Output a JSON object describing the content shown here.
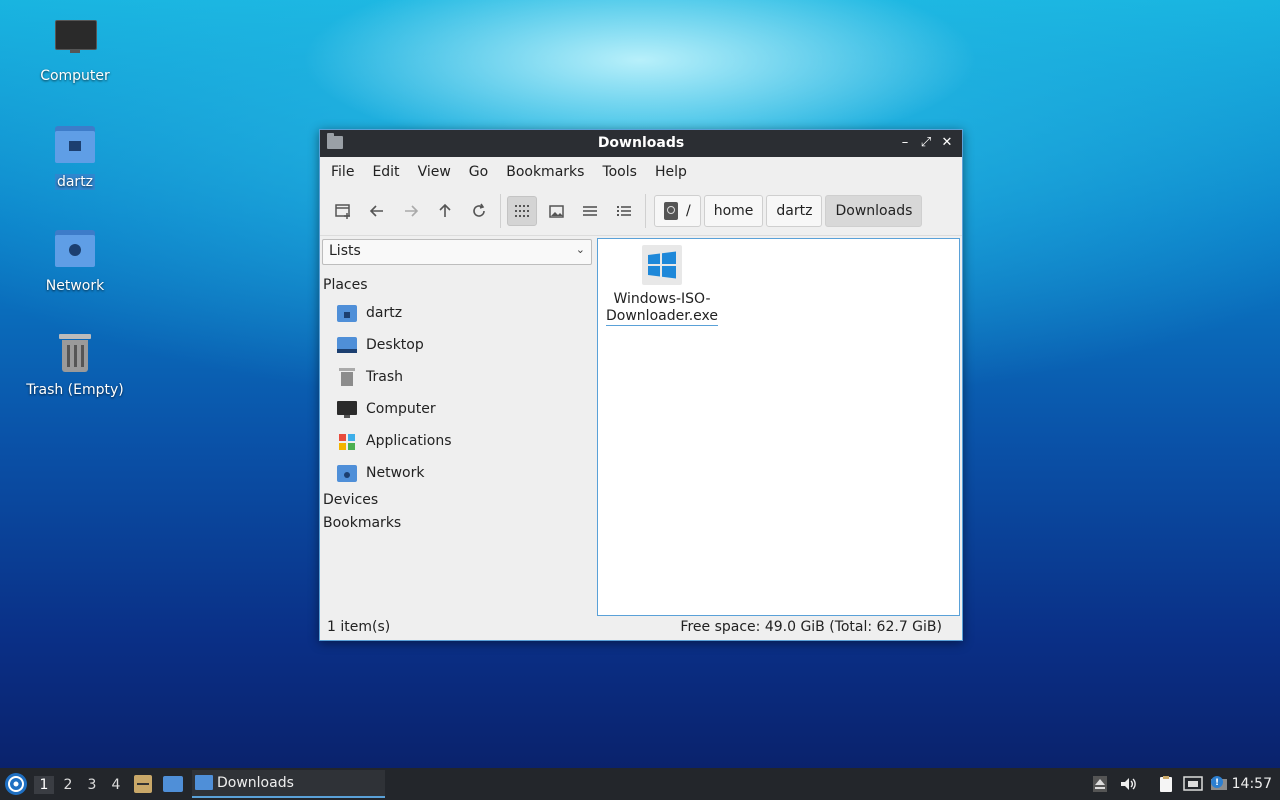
{
  "desktop": {
    "icons": [
      {
        "label": "Computer",
        "icon": "monitor-icon"
      },
      {
        "label": "dartz",
        "icon": "home-folder-icon"
      },
      {
        "label": "Network",
        "icon": "network-folder-icon"
      },
      {
        "label": "Trash (Empty)",
        "icon": "trash-icon"
      }
    ]
  },
  "window": {
    "title": "Downloads",
    "menu": [
      "File",
      "Edit",
      "View",
      "Go",
      "Bookmarks",
      "Tools",
      "Help"
    ],
    "breadcrumb": [
      "/",
      "home",
      "dartz",
      "Downloads"
    ],
    "sidebar": {
      "combo": "Lists",
      "sections": {
        "places": "Places",
        "devices": "Devices",
        "bookmarks": "Bookmarks"
      },
      "places": [
        {
          "label": "dartz",
          "icon": "home-folder-icon"
        },
        {
          "label": "Desktop",
          "icon": "desktop-icon"
        },
        {
          "label": "Trash",
          "icon": "trash-icon"
        },
        {
          "label": "Computer",
          "icon": "monitor-icon"
        },
        {
          "label": "Applications",
          "icon": "applications-icon"
        },
        {
          "label": "Network",
          "icon": "network-folder-icon"
        }
      ]
    },
    "files": [
      {
        "name_line1": "Windows-ISO-",
        "name_line2": "Downloader.exe",
        "icon": "windows-exe-icon"
      }
    ],
    "status": {
      "count": "1 item(s)",
      "space": "Free space: 49.0 GiB (Total: 62.7 GiB)"
    }
  },
  "taskbar": {
    "workspaces": [
      "1",
      "2",
      "3",
      "4"
    ],
    "task": "Downloads",
    "clock": "14:57"
  },
  "colors": {
    "accent": "#5aa1d8",
    "titlebar": "#2b2e33",
    "taskbar": "#23262b"
  }
}
